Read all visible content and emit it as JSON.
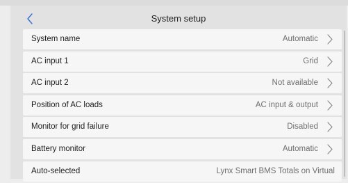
{
  "header": {
    "title": "System setup",
    "back_icon": "chevron-left-icon",
    "accent_color": "#2f6fd6"
  },
  "settings": [
    {
      "label": "System name",
      "value": "Automatic",
      "chevron": true
    },
    {
      "label": "AC input 1",
      "value": "Grid",
      "chevron": true
    },
    {
      "label": "AC input 2",
      "value": "Not available",
      "chevron": true
    },
    {
      "label": "Position of AC loads",
      "value": "AC input & output",
      "chevron": true
    },
    {
      "label": "Monitor for grid failure",
      "value": "Disabled",
      "chevron": true
    },
    {
      "label": "Battery monitor",
      "value": "Automatic",
      "chevron": true
    },
    {
      "label": "Auto-selected",
      "value": "Lynx Smart BMS Totals on Virtual",
      "chevron": false
    }
  ]
}
